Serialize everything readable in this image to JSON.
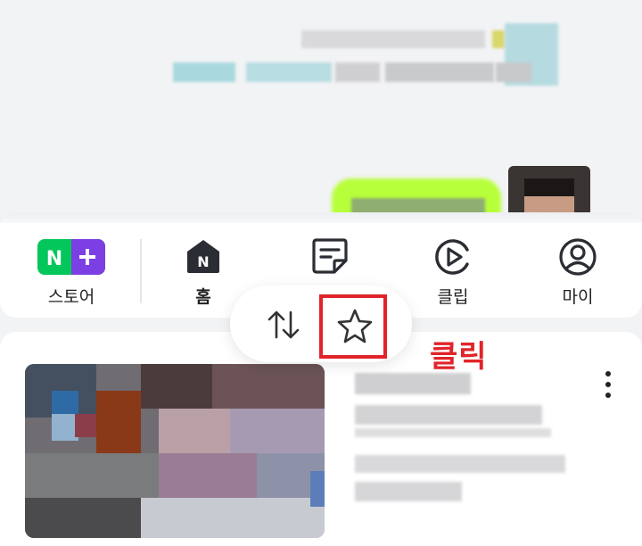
{
  "nav": {
    "items": [
      {
        "label": "스토어",
        "icon": "naver-plus-store-icon"
      },
      {
        "label": "홈",
        "icon": "home-n-icon"
      },
      {
        "label": "",
        "icon": "note-icon"
      },
      {
        "label": "클립",
        "icon": "clip-play-icon"
      },
      {
        "label": "마이",
        "icon": "profile-icon"
      }
    ]
  },
  "floating_bar": {
    "sort_icon": "sort-arrows-icon",
    "favorite_icon": "star-icon"
  },
  "annotation": {
    "click_text": "클릭",
    "color": "#e0242a"
  },
  "colors": {
    "store_green": "#03c75a",
    "store_purple": "#7b3fe4",
    "highlight_lime": "#b7ff3a"
  }
}
